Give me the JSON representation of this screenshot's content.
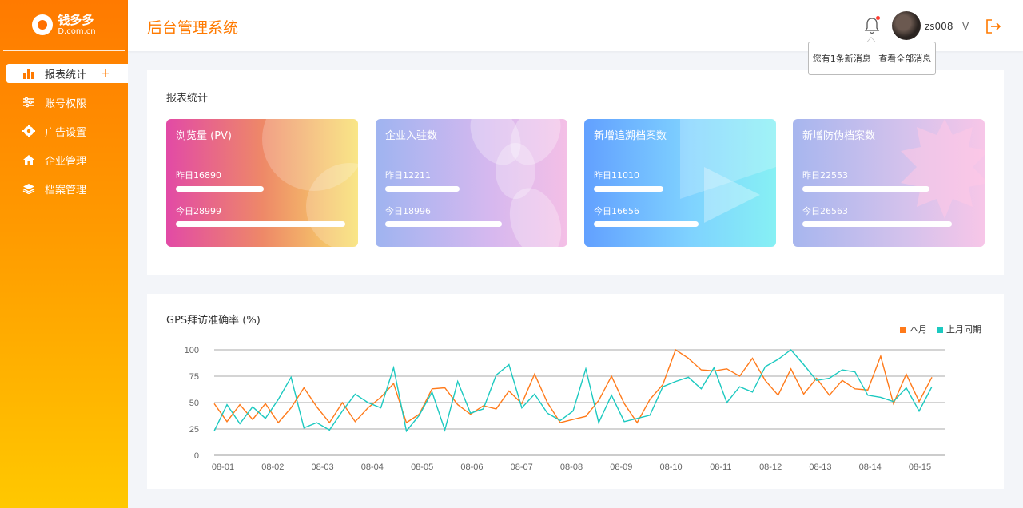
{
  "brand": {
    "name": "钱多多",
    "domain": "D.com.cn"
  },
  "sidebar": {
    "items": [
      {
        "label": "报表统计",
        "icon": "bar-chart-icon",
        "active": true,
        "plus": "+"
      },
      {
        "label": "账号权限",
        "icon": "sliders-icon"
      },
      {
        "label": "广告设置",
        "icon": "gear-icon"
      },
      {
        "label": "企业管理",
        "icon": "home-icon"
      },
      {
        "label": "档案管理",
        "icon": "layers-icon"
      }
    ]
  },
  "header": {
    "title": "后台管理系统",
    "username": "zs008",
    "chevron": "V",
    "notification": {
      "message": "您有1条新消息",
      "view_all": "查看全部消息"
    }
  },
  "stats": {
    "title": "报表统计",
    "cards": [
      {
        "title": "浏览量 (PV)",
        "yesterday": "昨日16890",
        "today": "今日28999",
        "yesterday_fill": 0.52,
        "today_fill": 1.0
      },
      {
        "title": "企业入驻数",
        "yesterday": "昨日12211",
        "today": "今日18996",
        "yesterday_fill": 0.44,
        "today_fill": 0.69
      },
      {
        "title": "新增追溯档案数",
        "yesterday": "昨日11010",
        "today": "今日16656",
        "yesterday_fill": 0.41,
        "today_fill": 0.62
      },
      {
        "title": "新增防伪档案数",
        "yesterday": "昨日22553",
        "today": "今日26563",
        "yesterday_fill": 0.75,
        "today_fill": 0.88
      }
    ]
  },
  "chart_data": {
    "type": "line",
    "title": "GPS拜访准确率 (%)",
    "xlabel": "",
    "ylabel": "",
    "ylim": [
      0,
      100
    ],
    "yticks": [
      0,
      25,
      50,
      75,
      100
    ],
    "x_tick_labels": [
      "08-01",
      "08-02",
      "08-03",
      "08-04",
      "08-05",
      "08-06",
      "08-07",
      "08-08",
      "08-09",
      "08-10",
      "08-11",
      "08-12",
      "08-13",
      "08-14",
      "08-15"
    ],
    "grid": true,
    "legend_position": "top-right",
    "series": [
      {
        "name": "本月",
        "color": "#ff7a1a",
        "values": [
          49,
          32,
          48,
          34,
          49,
          31,
          45,
          64,
          46,
          31,
          50,
          32,
          45,
          55,
          68,
          31,
          39,
          63,
          64,
          48,
          39,
          47,
          44,
          61,
          49,
          77,
          50,
          31,
          34,
          37,
          52,
          75,
          49,
          31,
          53,
          67,
          100,
          92,
          81,
          80,
          82,
          75,
          92,
          71,
          57,
          82,
          58,
          73,
          57,
          71,
          63,
          62,
          94,
          49,
          77,
          51,
          74
        ]
      },
      {
        "name": "上月同期",
        "color": "#1cc9c0",
        "values": [
          23,
          48,
          30,
          46,
          35,
          53,
          74,
          26,
          31,
          24,
          42,
          58,
          50,
          45,
          83,
          23,
          38,
          60,
          24,
          70,
          40,
          44,
          76,
          86,
          45,
          58,
          40,
          33,
          42,
          82,
          31,
          57,
          32,
          35,
          38,
          65,
          70,
          74,
          63,
          83,
          50,
          65,
          60,
          84,
          91,
          100,
          86,
          71,
          73,
          81,
          79,
          57,
          55,
          51,
          64,
          42,
          65
        ]
      }
    ]
  },
  "colors": {
    "accent": "#ff7a00",
    "series1": "#ff7a1a",
    "series2": "#1cc9c0"
  }
}
